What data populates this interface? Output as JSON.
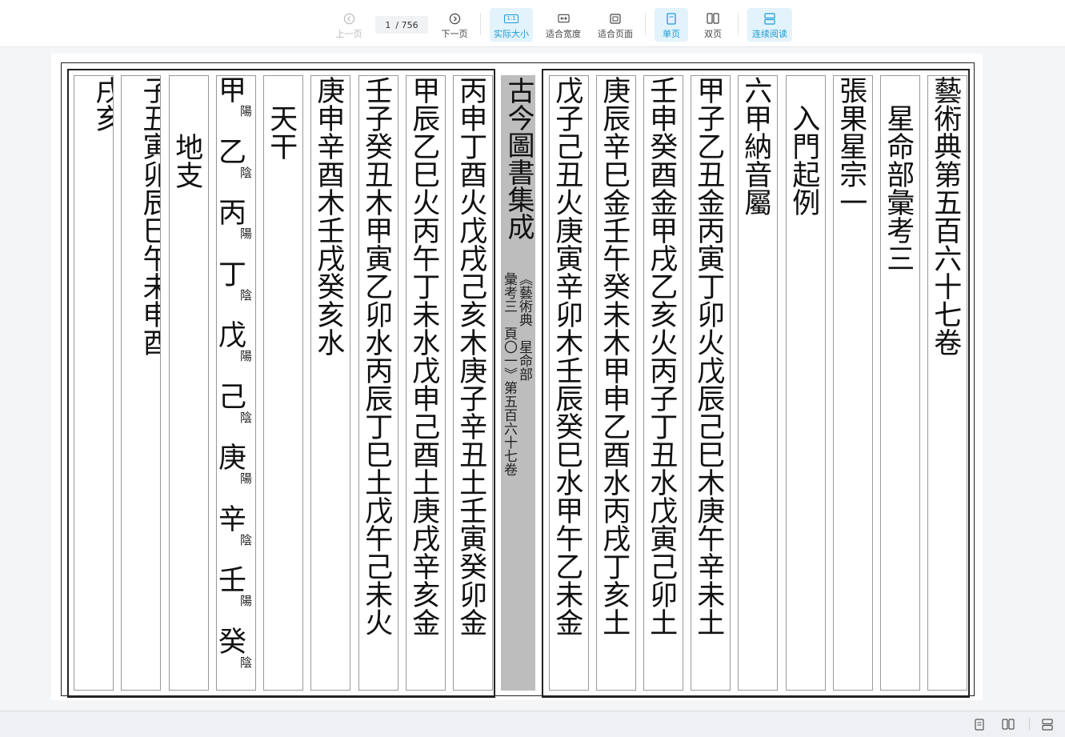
{
  "toolbar": {
    "prev_label": "上一页",
    "next_label": "下一页",
    "current_page": "1",
    "total_pages": "/ 756",
    "actual_size_label": "实际大小",
    "fit_width_label": "适合宽度",
    "fit_page_label": "适合页面",
    "single_label": "单页",
    "double_label": "双页",
    "continuous_label": "连续阅读",
    "actual_size_badge": "1:1"
  },
  "document": {
    "spine_title": "古今圖書集成",
    "spine_detail": "《藝術典　星命部\n彙考三　頁〇一》第五百六十七卷",
    "right_columns": [
      "藝術典第五百六十七卷",
      "　星命部彙考三",
      "張果星宗一",
      "　入門起例",
      "六甲納音屬",
      "甲子乙丑金丙寅丁卯火戊辰己巳木庚午辛未土",
      "壬申癸酉金甲戌乙亥火丙子丁丑水戊寅己卯土",
      "庚辰辛巳金壬午癸未木甲申乙酉水丙戌丁亥土",
      "戊子己丑火庚寅辛卯木壬辰癸巳水甲午乙未金"
    ],
    "left_columns": [
      "丙申丁酉火戊戌己亥木庚子辛丑土壬寅癸卯金",
      "甲辰乙巳火丙午丁未水戊申己酉土庚戌辛亥金",
      "壬子癸丑木甲寅乙卯水丙辰丁巳土戊午己未火",
      "庚申辛酉木壬戌癸亥水",
      "　天干"
    ],
    "stems": [
      {
        "c": "甲",
        "s": "陽"
      },
      {
        "c": "乙",
        "s": "陰"
      },
      {
        "c": "丙",
        "s": "陽"
      },
      {
        "c": "丁",
        "s": "陰"
      },
      {
        "c": "戊",
        "s": "陽"
      },
      {
        "c": "己",
        "s": "陰"
      },
      {
        "c": "庚",
        "s": "陽"
      },
      {
        "c": "辛",
        "s": "陰"
      },
      {
        "c": "壬",
        "s": "陽"
      },
      {
        "c": "癸",
        "s": "陰"
      }
    ],
    "branches_header": "　地支",
    "branches_col1": "子丑寅卯辰巳午未申酉",
    "branches_col2": "戌亥"
  }
}
